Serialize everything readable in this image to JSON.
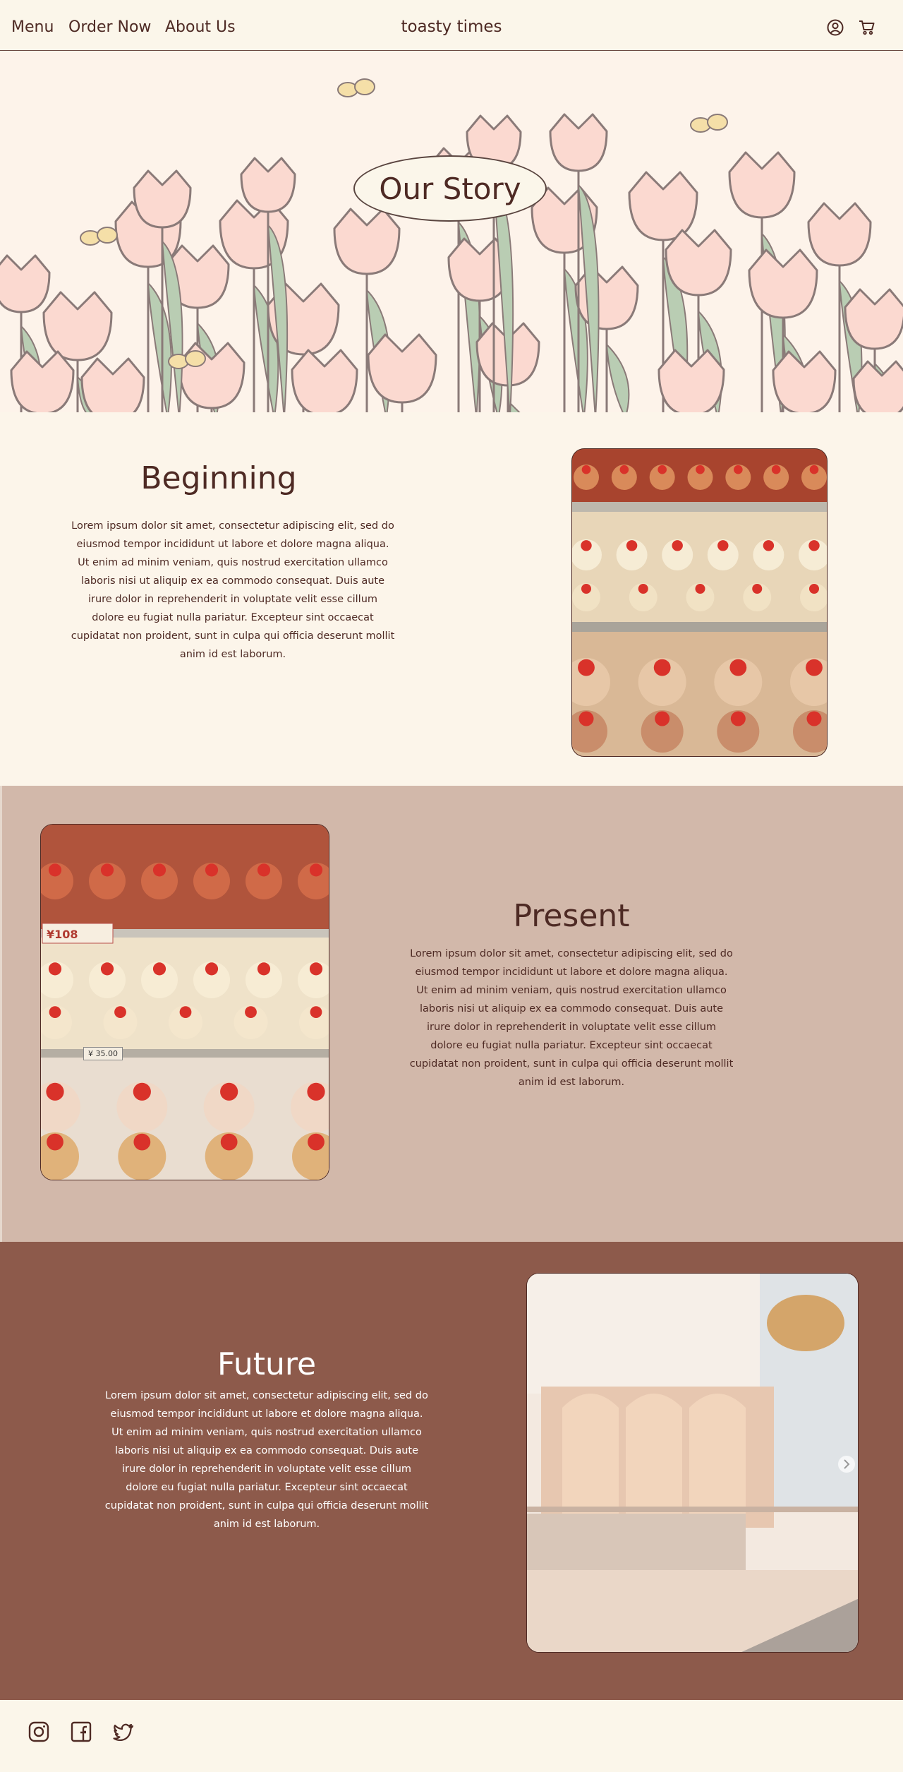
{
  "header": {
    "nav": [
      "Menu",
      "Order Now",
      "About Us"
    ],
    "brand": "toasty times",
    "icons": [
      "user-circle-icon",
      "cart-icon"
    ]
  },
  "hero": {
    "title": "Our Story"
  },
  "sections": [
    {
      "title": "Beginning",
      "body": "Lorem ipsum dolor sit amet, consectetur adipiscing elit, sed do eiusmod tempor incididunt ut labore et dolore magna aliqua. Ut enim ad minim veniam, quis nostrud exercitation ullamco laboris nisi ut aliquip ex ea commodo consequat. Duis aute irure dolor in reprehenderit in voluptate velit esse cillum dolore eu fugiat nulla pariatur. Excepteur sint occaecat cupidatat non proident, sunt in culpa qui officia deserunt mollit anim id est laborum."
    },
    {
      "title": "Present",
      "body": "Lorem ipsum dolor sit amet, consectetur adipiscing elit, sed do eiusmod tempor incididunt ut labore et dolore magna aliqua. Ut enim ad minim veniam, quis nostrud exercitation ullamco laboris nisi ut aliquip ex ea commodo consequat. Duis aute irure dolor in reprehenderit in voluptate velit esse cillum dolore eu fugiat nulla pariatur. Excepteur sint occaecat cupidatat non proident, sunt in culpa qui officia deserunt mollit anim id est laborum."
    },
    {
      "title": "Future",
      "body": "Lorem ipsum dolor sit amet, consectetur adipiscing elit, sed do eiusmod tempor incididunt ut labore et dolore magna aliqua. Ut enim ad minim veniam, quis nostrud exercitation ullamco laboris nisi ut aliquip ex ea commodo consequat. Duis aute irure dolor in reprehenderit in voluptate velit esse cillum dolore eu fugiat nulla pariatur. Excepteur sint occaecat cupidatat non proident, sunt in culpa qui officia deserunt mollit anim id est laborum."
    }
  ],
  "photo_price_label": "¥108",
  "photo_price_label_2": "¥ 35.00",
  "footer": {
    "icons": [
      "instagram-icon",
      "facebook-icon",
      "twitter-icon"
    ]
  },
  "colors": {
    "header_bg": "#fbf6ea",
    "text_dark": "#4e2a24",
    "present_bg": "#d2b8aa",
    "future_bg": "#8d5a4b",
    "tulip_pink": "#fbd9d0",
    "leaf_green": "#b9cdb3"
  }
}
